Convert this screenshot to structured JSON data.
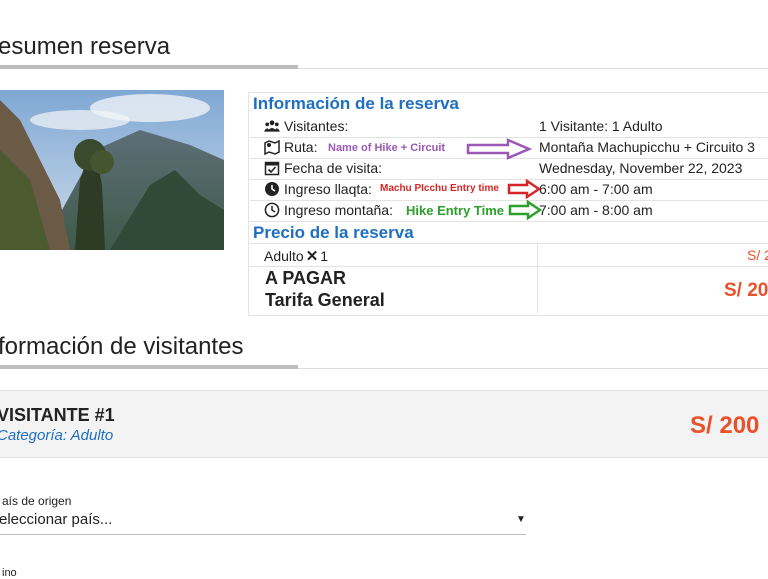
{
  "summary": {
    "title": "esumen reserva"
  },
  "reservation": {
    "info_title": "Información de la reserva",
    "rows": [
      {
        "icon": "users-icon",
        "label": "Visitantes:",
        "value": "1 Visitante: 1 Adulto"
      },
      {
        "icon": "map-route-icon",
        "label": "Ruta:",
        "value": "Montaña Machupicchu + Circuito 3"
      },
      {
        "icon": "calendar-check-icon",
        "label": "Fecha de visita:",
        "value": "Wednesday, November 22, 2023"
      },
      {
        "icon": "clock-filled-icon",
        "label": "Ingreso llaqta:",
        "value": "6:00 am - 7:00 am"
      },
      {
        "icon": "clock-outline-icon",
        "label": "Ingreso montaña:",
        "value": "7:00 am - 8:00 am"
      }
    ],
    "annotations": {
      "route": "Name of Hike + Circuit",
      "llaqta": "Machu PIcchu Entry time",
      "mountain": "Hike Entry Time"
    },
    "price_title": "Precio de la reserva",
    "price_row_label": "Adulto",
    "price_row_qty": "1",
    "price_row_value": "S/ 2",
    "total_label": "A PAGAR",
    "tariff_label": "Tarifa General",
    "total_value": "S/ 200"
  },
  "visitors_section": {
    "title": "formación de visitantes"
  },
  "visitor": {
    "heading": "VISITANTE #1",
    "category": "Categoría: Adulto",
    "price": "S/ 200",
    "country_label": "aís de origen",
    "country_placeholder": "eleccionar país...",
    "next_label": "ino"
  },
  "colors": {
    "accent_blue": "#1f6fc0",
    "price_orange": "#e8512a",
    "arrow_purple": "#9b59b6",
    "arrow_red": "#d62728",
    "arrow_green": "#2ca02c"
  }
}
